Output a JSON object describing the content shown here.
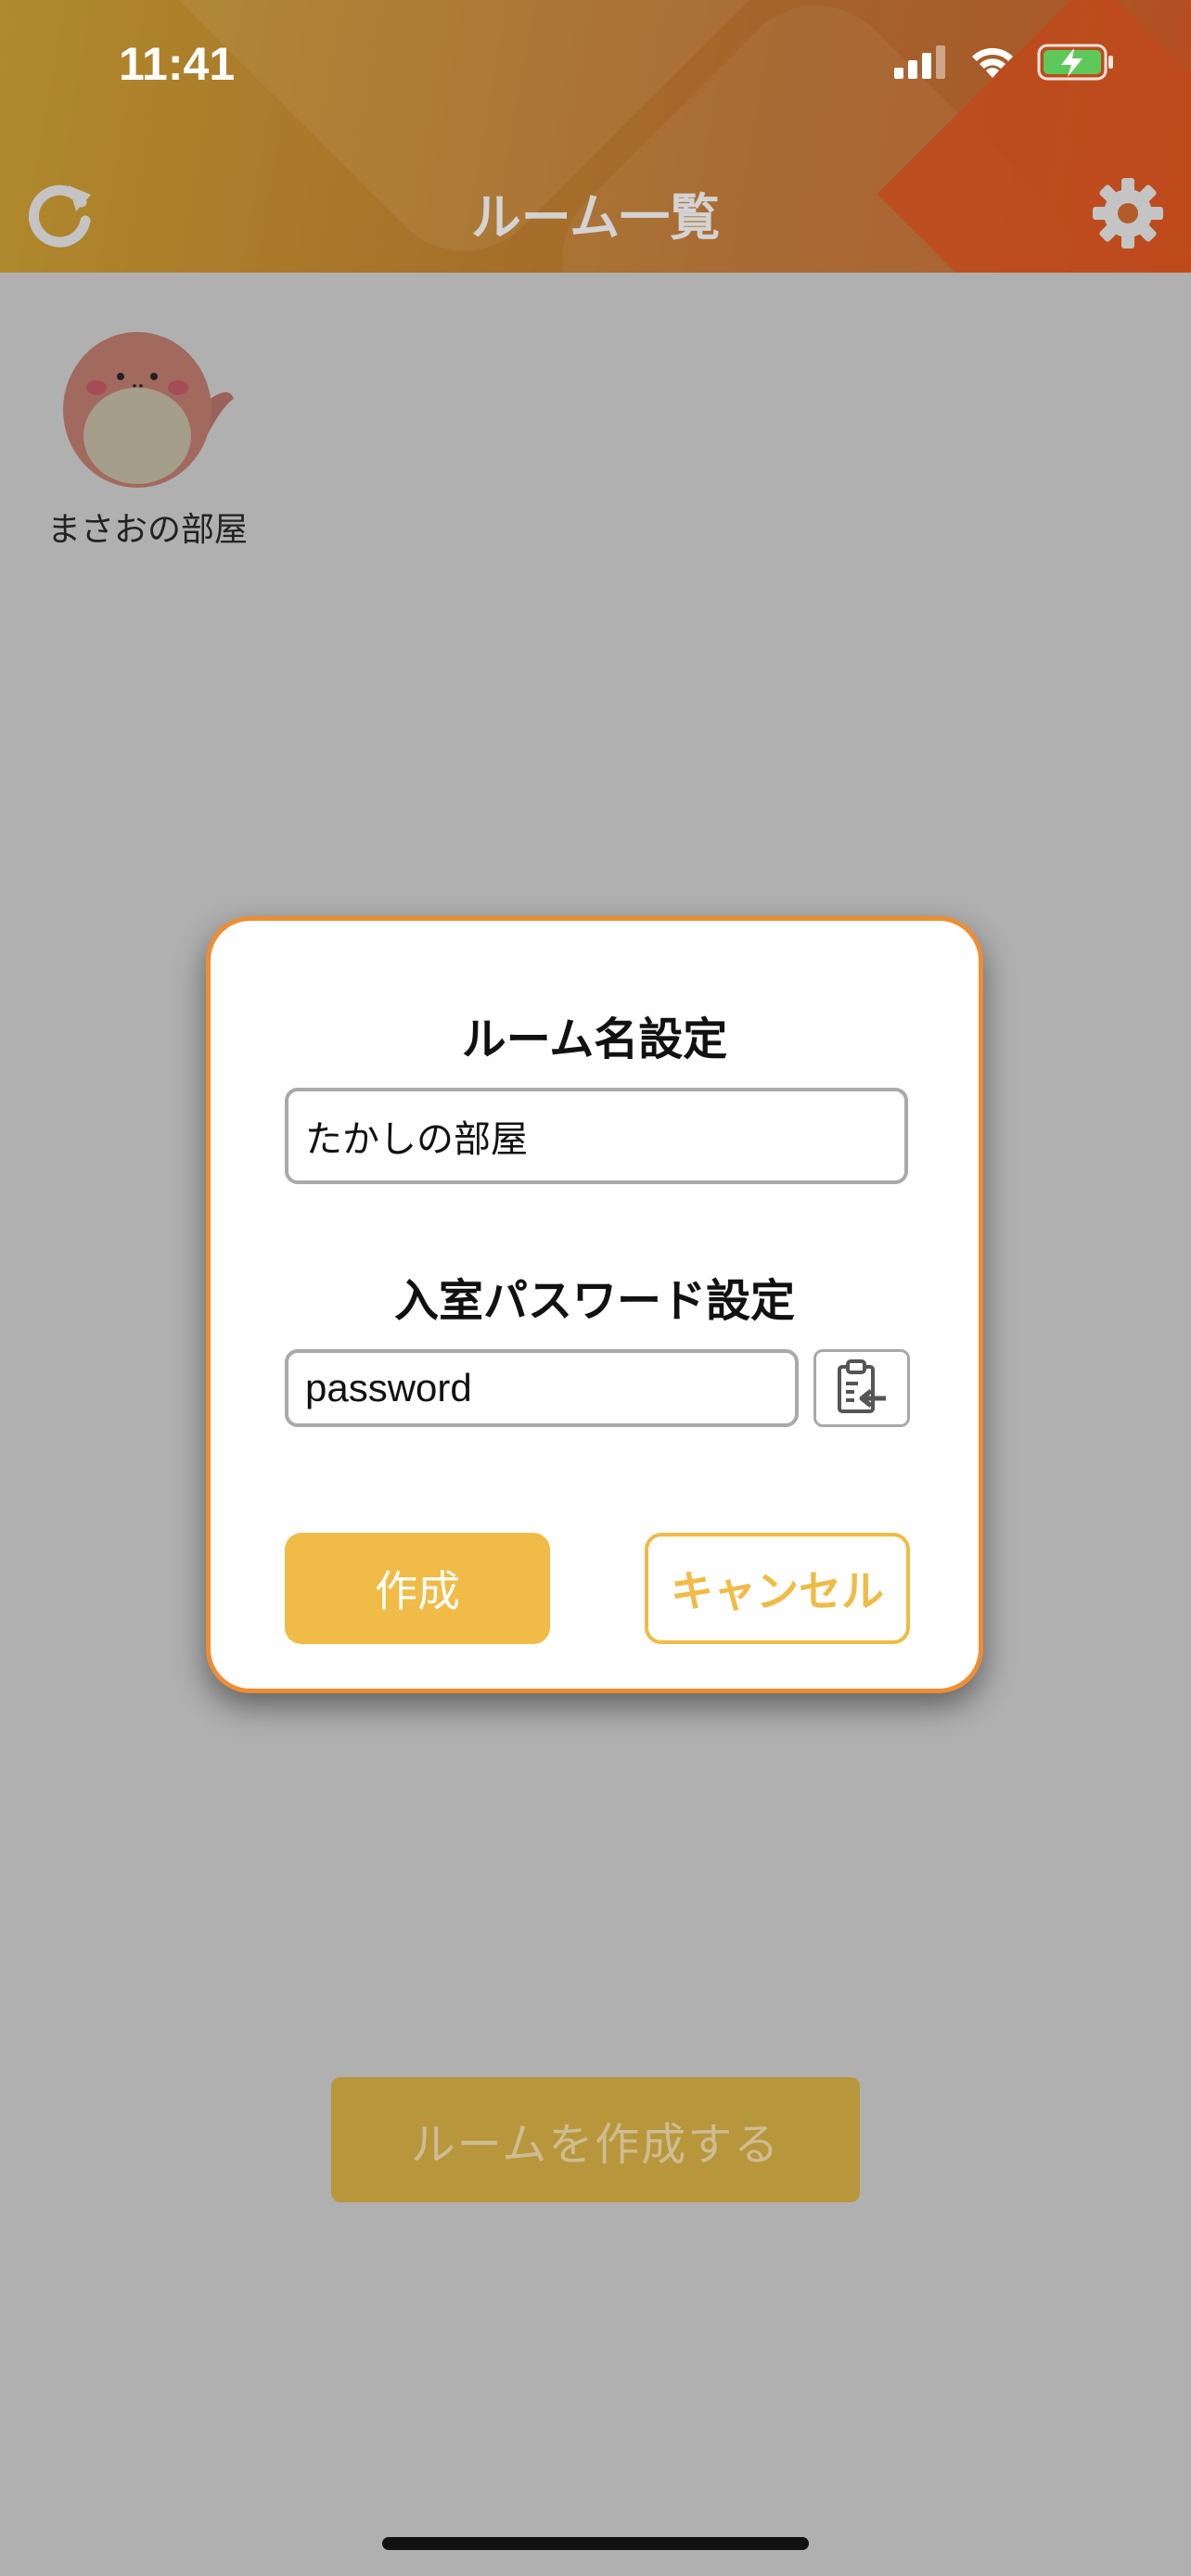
{
  "status_bar": {
    "time": "11:41"
  },
  "header": {
    "title": "ルーム一覧"
  },
  "rooms": [
    {
      "name": "まさおの部屋"
    }
  ],
  "create_room_button_label": "ルームを作成する",
  "modal": {
    "room_name_label": "ルーム名設定",
    "room_name_value": "たかしの部屋",
    "password_label": "入室パスワード設定",
    "password_value": "password",
    "create_label": "作成",
    "cancel_label": "キャンセル"
  },
  "colors": {
    "accent_yellow": "#f0bb46",
    "modal_border": "#ef8d33",
    "overlay_gray": "#b0b0b0"
  },
  "icons": {
    "refresh": "refresh-icon",
    "settings": "gear-icon",
    "paste": "clipboard-paste-icon",
    "signal": "signal-icon",
    "wifi": "wifi-icon",
    "battery": "battery-charging-icon"
  }
}
